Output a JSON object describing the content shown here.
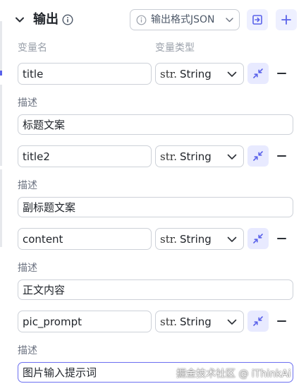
{
  "header": {
    "title": "输出",
    "format_select_label": "输出格式JSON"
  },
  "columns": {
    "name": "变量名",
    "type": "变量类型"
  },
  "outputs": [
    {
      "name": "title",
      "type_prefix": "str.",
      "type": "String",
      "description_label": "描述",
      "description": "标题文案"
    },
    {
      "name": "title2",
      "type_prefix": "str.",
      "type": "String",
      "description_label": "描述",
      "description": "副标题文案"
    },
    {
      "name": "content",
      "type_prefix": "str.",
      "type": "String",
      "description_label": "描述",
      "description": "正文内容"
    },
    {
      "name": "pic_prompt",
      "type_prefix": "str.",
      "type": "String",
      "description_label": "描述",
      "description": "图片输入提示词"
    }
  ],
  "watermark": "掘金技术社区 @ iThinkAi",
  "colors": {
    "accent": "#5a62ea",
    "button_bg": "#eef0ff",
    "border": "#cdd1d8",
    "focused_border": "#6b6ff0"
  },
  "icons": {
    "collapse": "chevron-down-icon",
    "info": "info-circle-icon",
    "export": "export-icon",
    "add": "plus-icon",
    "shrink": "shrink-arrows-icon",
    "remove": "minus-icon"
  }
}
